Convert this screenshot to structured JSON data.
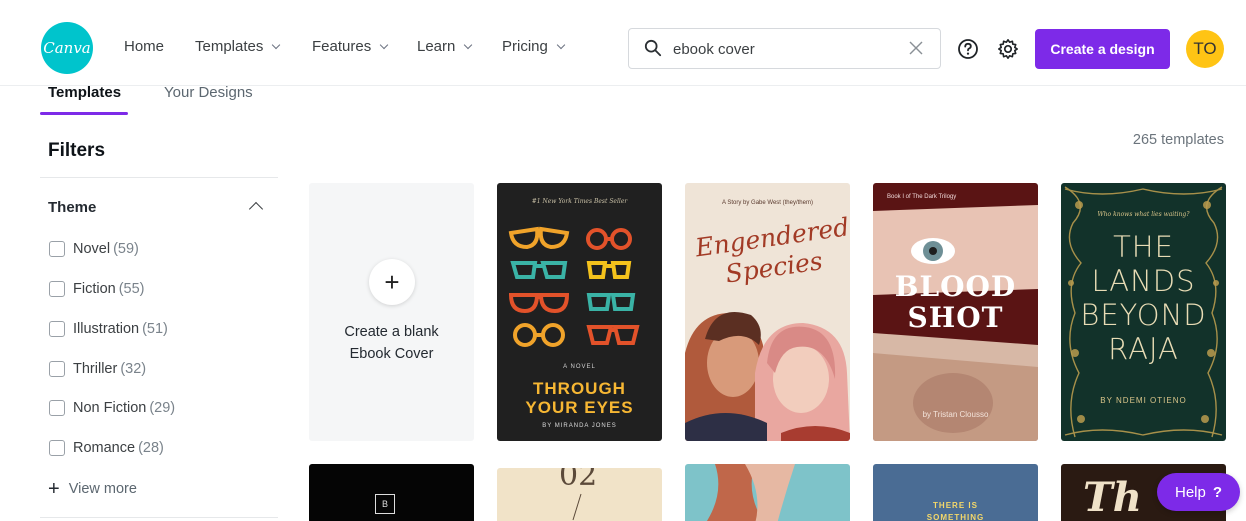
{
  "nav": {
    "logo_text": "Canva",
    "items": [
      {
        "label": "Home",
        "has_dropdown": false
      },
      {
        "label": "Templates",
        "has_dropdown": true
      },
      {
        "label": "Features",
        "has_dropdown": true
      },
      {
        "label": "Learn",
        "has_dropdown": true
      },
      {
        "label": "Pricing",
        "has_dropdown": true
      }
    ],
    "search": {
      "value": "ebook cover",
      "icon": "search-icon",
      "clear_icon": "close-icon"
    },
    "help_icon": "question-circle-icon",
    "settings_icon": "gear-icon",
    "create_button": "Create a design",
    "avatar_initials": "TO",
    "accent_color": "#7d2ae8",
    "avatar_color": "#ffc414"
  },
  "tabs": [
    {
      "label": "Templates",
      "active": true
    },
    {
      "label": "Your Designs",
      "active": false
    }
  ],
  "sidebar": {
    "title": "Filters",
    "section_title": "Theme",
    "items": [
      {
        "label": "Novel",
        "count": "(59)"
      },
      {
        "label": "Fiction",
        "count": "(55)"
      },
      {
        "label": "Illustration",
        "count": "(51)"
      },
      {
        "label": "Thriller",
        "count": "(32)"
      },
      {
        "label": "Non Fiction",
        "count": "(29)"
      },
      {
        "label": "Romance",
        "count": "(28)"
      }
    ],
    "view_more": "View more"
  },
  "results": {
    "count_text": "265 templates",
    "blank_card": {
      "label": "Create a blank Ebook Cover",
      "icon": "plus-icon"
    },
    "covers": [
      {
        "top_text": "#1 New York Times Best Seller",
        "label": "A NOVEL",
        "title_line1": "THROUGH",
        "title_line2": "YOUR EYES",
        "author": "BY MIRANDA JONES"
      },
      {
        "top_text": "A Story by Gabe West (they/them)",
        "title_line1": "Engendered",
        "title_line2": "Species"
      },
      {
        "top_text": "Book I of The Dark Trilogy",
        "title_line1": "BLOOD",
        "title_line2": "SHOT",
        "author": "by Tristan Clousso"
      },
      {
        "top_text": "Who knows what lies waiting?",
        "title_line1": "THE",
        "title_line2": "LANDS",
        "title_line3": "BEYOND",
        "title_line4": "RAJA",
        "author": "BY NDEMI OTIENO"
      }
    ],
    "row2": {
      "b_label": "B",
      "number": "02",
      "phrase_line1": "THERE IS",
      "phrase_line2": "SOMETHING",
      "script_text": "Th"
    }
  },
  "help": {
    "label": "Help",
    "symbol": "?"
  }
}
